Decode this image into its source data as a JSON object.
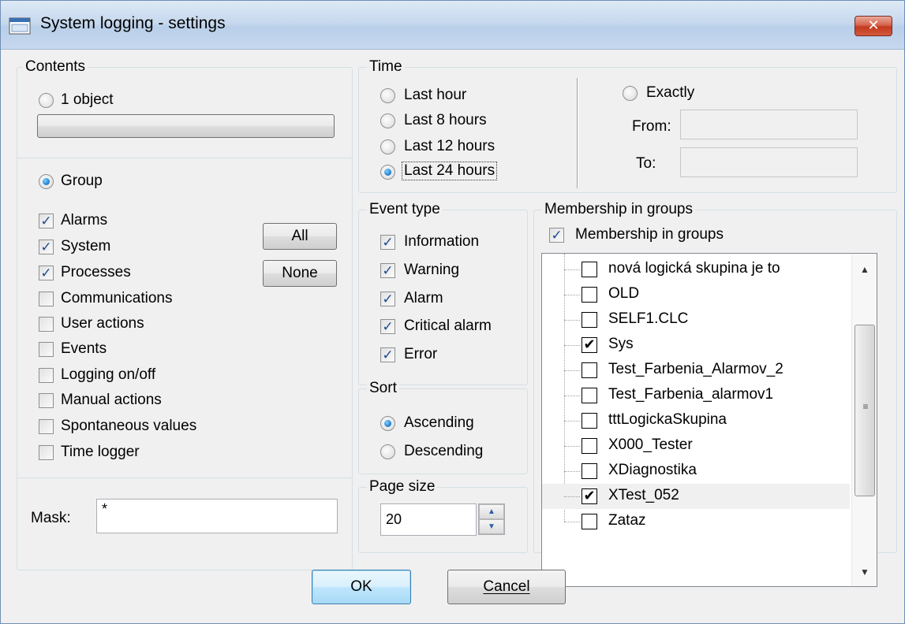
{
  "window": {
    "title": "System logging - settings",
    "close_glyph": "✕",
    "app_icon": "window-app-icon"
  },
  "contents": {
    "label": "Contents",
    "one_object_label": "1 object",
    "group_label": "Group",
    "categories": [
      {
        "label": "Alarms",
        "checked": true
      },
      {
        "label": "System",
        "checked": true
      },
      {
        "label": "Processes",
        "checked": true
      },
      {
        "label": "Communications",
        "checked": false
      },
      {
        "label": "User actions",
        "checked": false
      },
      {
        "label": "Events",
        "checked": false
      },
      {
        "label": "Logging on/off",
        "checked": false
      },
      {
        "label": "Manual actions",
        "checked": false
      },
      {
        "label": "Spontaneous values",
        "checked": false
      },
      {
        "label": "Time logger",
        "checked": false
      }
    ],
    "all_button": "All",
    "none_button": "None",
    "mask_label": "Mask:",
    "mask_value": "*"
  },
  "time": {
    "label": "Time",
    "options": [
      {
        "label": "Last hour",
        "selected": false
      },
      {
        "label": "Last 8 hours",
        "selected": false
      },
      {
        "label": "Last 12 hours",
        "selected": false
      },
      {
        "label": "Last 24 hours",
        "selected": true
      }
    ],
    "exactly_label": "Exactly",
    "from_label": "From:",
    "to_label": "To:",
    "from_value": "",
    "to_value": ""
  },
  "event_type": {
    "label": "Event type",
    "items": [
      {
        "label": "Information",
        "checked": true
      },
      {
        "label": "Warning",
        "checked": true
      },
      {
        "label": "Alarm",
        "checked": true
      },
      {
        "label": "Critical alarm",
        "checked": true
      },
      {
        "label": "Error",
        "checked": true
      }
    ]
  },
  "sort": {
    "label": "Sort",
    "ascending": "Ascending",
    "descending": "Descending",
    "selected": "Ascending"
  },
  "page_size": {
    "label": "Page size",
    "value": "20"
  },
  "membership": {
    "label": "Membership in groups",
    "checkbox_label": "Membership in groups",
    "checked": true,
    "items": [
      {
        "label": "nová logická skupina je to",
        "checked": false
      },
      {
        "label": "OLD",
        "checked": false
      },
      {
        "label": "SELF1.CLC",
        "checked": false
      },
      {
        "label": "Sys",
        "checked": true
      },
      {
        "label": "Test_Farbenia_Alarmov_2",
        "checked": false
      },
      {
        "label": "Test_Farbenia_alarmov1",
        "checked": false
      },
      {
        "label": "tttLogickaSkupina",
        "checked": false
      },
      {
        "label": "X000_Tester",
        "checked": false
      },
      {
        "label": "XDiagnostika",
        "checked": false
      },
      {
        "label": "XTest_052",
        "checked": true
      },
      {
        "label": "Zataz",
        "checked": false
      }
    ]
  },
  "buttons": {
    "ok": "OK",
    "cancel": "Cancel"
  }
}
